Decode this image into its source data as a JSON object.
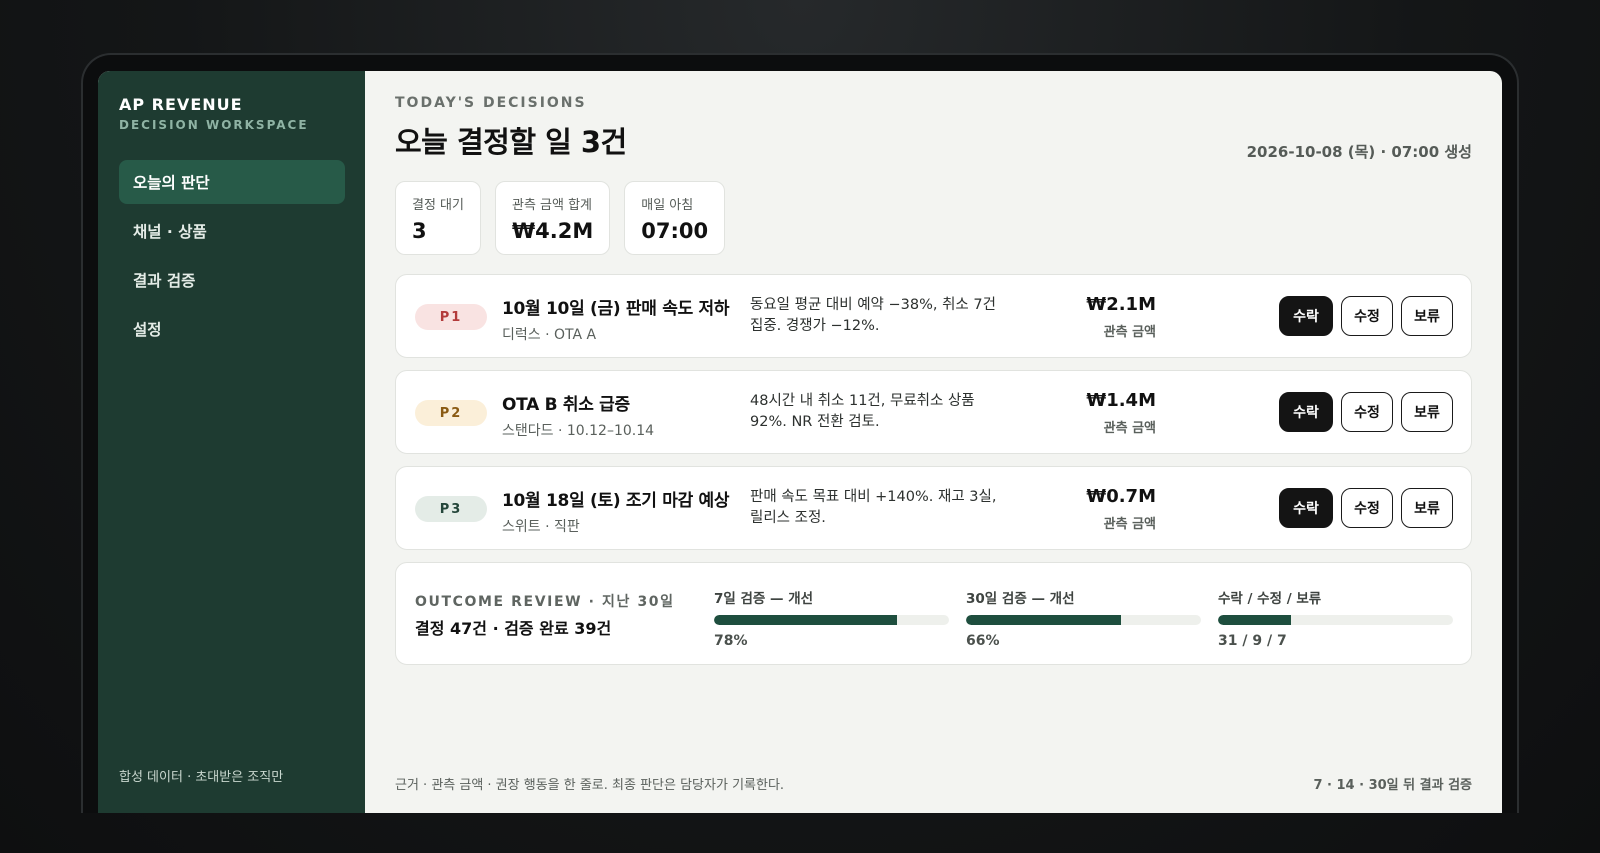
{
  "sidebar": {
    "brand": "AP REVENUE",
    "brand_sub": "DECISION WORKSPACE",
    "items": [
      {
        "label": "오늘의 판단",
        "active": true
      },
      {
        "label": "채널 · 상품"
      },
      {
        "label": "결과 검증"
      },
      {
        "label": "설정"
      }
    ],
    "footer": "합성 데이터 · 초대받은 조직만"
  },
  "header": {
    "eyebrow": "TODAY'S DECISIONS",
    "title": "오늘 결정할 일 3건",
    "timestamp": "2026-10-08 (목) · 07:00 생성"
  },
  "stats": [
    {
      "label": "결정 대기",
      "value": "3"
    },
    {
      "label": "관측 금액 합계",
      "value": "₩4.2M"
    },
    {
      "label": "매일 아침",
      "value": "07:00"
    }
  ],
  "decisions": [
    {
      "priority": "P1",
      "title": "10월 10일 (금) 판매 속도 저하",
      "subtitle": "디럭스 · OTA A",
      "description": "동요일 평균 대비 예약 −38%, 취소 7건 집중. 경쟁가 −12%.",
      "amount": "₩2.1M",
      "amount_label": "관측 금액"
    },
    {
      "priority": "P2",
      "title": "OTA B 취소 급증",
      "subtitle": "스탠다드 · 10.12–10.14",
      "description": "48시간 내 취소 11건, 무료취소 상품 92%. NR 전환 검토.",
      "amount": "₩1.4M",
      "amount_label": "관측 금액"
    },
    {
      "priority": "P3",
      "title": "10월 18일 (토) 조기 마감 예상",
      "subtitle": "스위트 · 직판",
      "description": "판매 속도 목표 대비 +140%. 재고 3실, 릴리스 조정.",
      "amount": "₩0.7M",
      "amount_label": "관측 금액"
    }
  ],
  "actions": {
    "accept": "수락",
    "edit": "수정",
    "hold": "보류"
  },
  "outcome": {
    "eyebrow": "OUTCOME REVIEW · 지난 30일",
    "title": "결정 47건 · 검증 완료 39건",
    "metrics": [
      {
        "label": "7일 검증 — 개선",
        "value": "78%",
        "fill": 0.78
      },
      {
        "label": "30일 검증 — 개선",
        "value": "66%",
        "fill": 0.66
      },
      {
        "label": "수락 / 수정 / 보류",
        "value": "31 / 9 / 7",
        "fill": 0.31
      }
    ]
  },
  "footer": {
    "left": "근거 · 관측 금액 · 권장 행동을 한 줄로. 최종 판단은 담당자가 기록한다.",
    "right": "7 · 14 · 30일 뒤 결과 검증"
  }
}
